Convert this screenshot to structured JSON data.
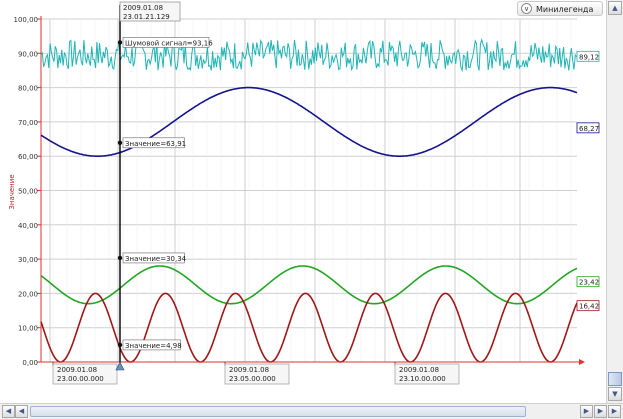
{
  "legend": {
    "label": "Минилегенда",
    "toggle_icon": "chevron-down-icon"
  },
  "chart_data": {
    "type": "line",
    "ylabel": "Значение",
    "ylim": [
      0,
      100
    ],
    "yticks": [
      "0,00",
      "10,00",
      "20,00",
      "30,00",
      "40,00",
      "50,00",
      "60,00",
      "70,00",
      "80,00",
      "90,00",
      "100,00"
    ],
    "xtick_labels": [
      {
        "date": "2009.01.08",
        "time": "23.00.00.000"
      },
      {
        "date": "2009.01.08",
        "time": "23.05.00.000"
      },
      {
        "date": "2009.01.08",
        "time": "23.10.00.000"
      }
    ],
    "cursor": {
      "date": "2009.01.08",
      "time": "23.01.21.129",
      "readouts": [
        {
          "series": "noise",
          "text": "Шумовой сигнал=93,16",
          "value": 93.16
        },
        {
          "series": "blue",
          "text": "Значение=63,91",
          "value": 63.91
        },
        {
          "series": "green",
          "text": "Значение=30,34",
          "value": 30.34
        },
        {
          "series": "red",
          "text": "Значение=4,98",
          "value": 4.98
        }
      ]
    },
    "series": [
      {
        "color": "#1fb5b5",
        "kind": "noise",
        "center": 89.5,
        "amplitude": 4.5,
        "end_label": "89,12",
        "end_value": 89.12
      },
      {
        "color": "#14148c",
        "kind": "sine",
        "center": 70,
        "amplitude": 10,
        "end_label": "68,27",
        "end_value": 68.27
      },
      {
        "color": "#22a622",
        "kind": "sine",
        "center": 22.5,
        "amplitude": 5.5,
        "end_label": "23,42",
        "end_value": 23.42
      },
      {
        "color": "#a01818",
        "kind": "sine",
        "center": 10,
        "amplitude": 10,
        "end_label": "16,42",
        "end_value": 16.42
      }
    ],
    "colors": {
      "axis": "#e03030",
      "grid": "#cfcfcf",
      "cursor": "#000000"
    }
  }
}
